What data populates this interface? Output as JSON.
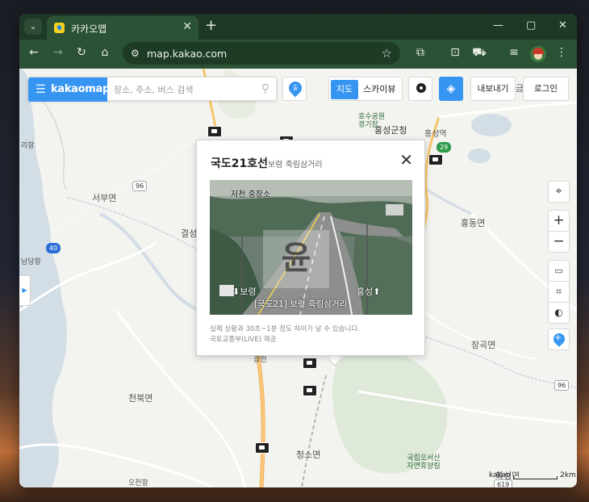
{
  "browser": {
    "tab_title": "카카오맵",
    "url": "map.kakao.com"
  },
  "icons": {
    "tab_menu": "chevron-down-icon",
    "close": "close-icon",
    "new_tab": "plus-icon",
    "minimize": "minimize-icon",
    "maximize": "maximize-icon",
    "back": "arrow-left-icon",
    "forward": "arrow-right-icon",
    "reload": "reload-icon",
    "home": "home-icon",
    "site_info": "tune-icon",
    "bookmark": "star-icon",
    "extensions": "puzzle-icon",
    "menu": "more-vert-icon"
  },
  "search": {
    "brand": "kakaomap",
    "placeholder": "장소, 주소, 버스 검색"
  },
  "top_controls": {
    "route_label": "출",
    "map_label": "지도",
    "sky_label": "스카이뷰",
    "export_label": "내보내기",
    "login_label": "로그인"
  },
  "map_labels": [
    {
      "text": "홍성군청"
    },
    {
      "text": "홍성역"
    },
    {
      "text": "서부면"
    },
    {
      "text": "결성"
    },
    {
      "text": "홍동면"
    },
    {
      "text": "장곡면"
    },
    {
      "text": "천북면"
    },
    {
      "text": "청소면"
    },
    {
      "text": "국립오서산자연휴양림"
    },
    {
      "text": "오천항"
    },
    {
      "text": "광천"
    },
    {
      "text": "화성면"
    },
    {
      "text": "금"
    },
    {
      "text": "리항"
    },
    {
      "text": "남당항"
    },
    {
      "text": "호수공원"
    },
    {
      "text": "경기장"
    }
  ],
  "road_badges": [
    "96",
    "40",
    "29",
    "96",
    "619"
  ],
  "popup": {
    "title": "국도21호선",
    "subtitle": "보령 죽림삼거리",
    "cam_overlay_top": "저천 중장소",
    "cam_overlay_left": "⬇보령",
    "cam_overlay_right": "홍성⬆",
    "cam_overlay_bottom": "[국도21] 보령 죽림삼거리",
    "cam_watermark": "윤",
    "notice_line1": "실제 상황과 30초~1분 정도 차이가 날 수 있습니다.",
    "notice_line2": "국토교통부(LIVE) 제공"
  },
  "scale": {
    "brand": "kakao",
    "distance": "2km"
  },
  "colors": {
    "brand_blue": "#3695f1",
    "browser_green": "#2c5235"
  }
}
